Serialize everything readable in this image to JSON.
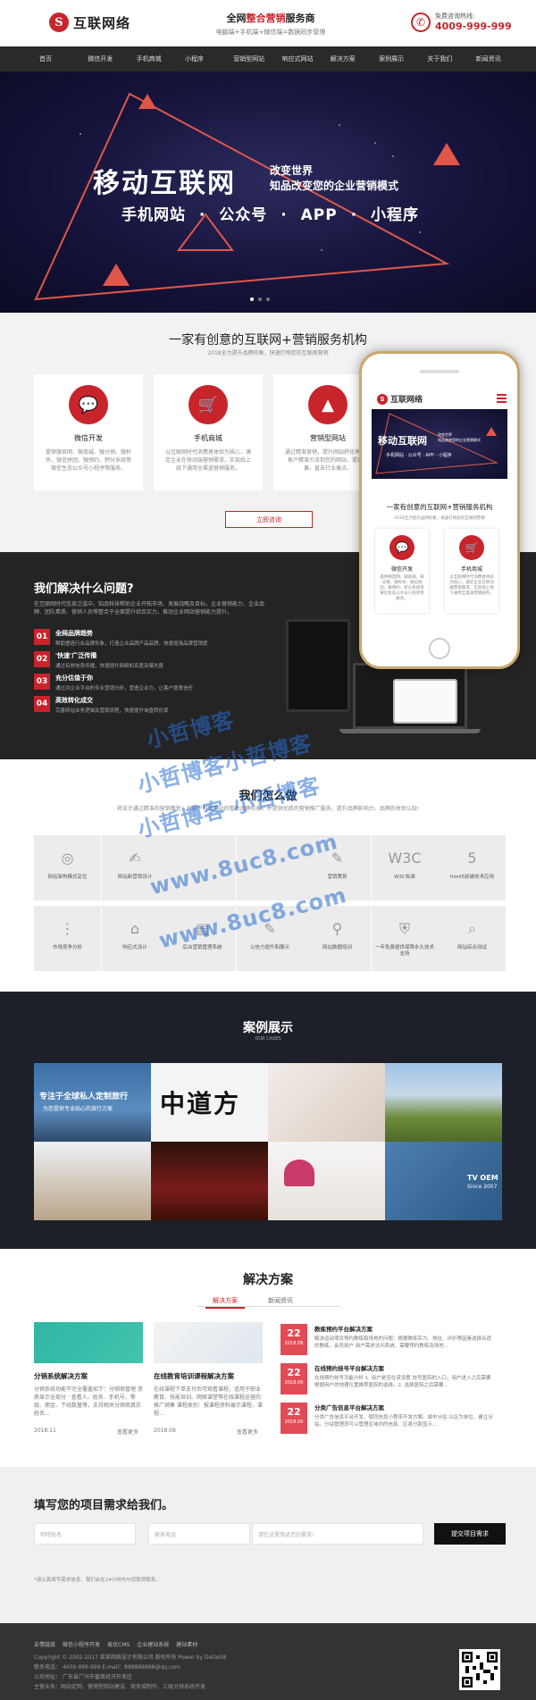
{
  "header": {
    "logo_letter": "S",
    "logo_text": "互联网络",
    "slogan_pre": "全网",
    "slogan_red": "整合营销",
    "slogan_post": "服务商",
    "slogan_sub": "电脑端+手机端+微信端=数据同步管理",
    "phone_label": "免费咨询热线:",
    "phone_number": "4009-999-999"
  },
  "nav": [
    "首页",
    "微信开发",
    "手机商城",
    "小程序",
    "营销型网站",
    "响应式网站",
    "解决方案",
    "案例展示",
    "关于我们",
    "新闻资讯"
  ],
  "banner": {
    "title": "移动互联网",
    "sub1": "改变世界",
    "sub2": "知品改变您的企业营销模式",
    "line": "手机网站 · 公众号 · APP · 小程序"
  },
  "intro": {
    "title": "一家有创意的互联网+营销服务机构",
    "subtitle": "2018全力提升品牌形象，快速打响您的互联网营销",
    "cards": [
      {
        "title": "微信开发",
        "desc": "提供微官网、微商城、微分销、微秒杀、微信拼团、微预约、积分系统等微信生态公众号小程序等服务。"
      },
      {
        "title": "手机商城",
        "desc": "以互联网时代消费者体验为核心，满足企业在移动端营销需求，实现线上线下通用全渠道营销服务。"
      },
      {
        "title": "营销型网站",
        "desc": "通过精准营销，提升网站转化率，将客户精准引流到您的网站，提升效果，直击行业痛点。"
      }
    ],
    "button": "立即咨询"
  },
  "solve": {
    "title": "我们解决什么问题?",
    "desc": "在互联网时代信息泛滥中，知品科技帮助企业开拓市场、发展战略及目标，企业营销能力、企业品牌、团队素质、营销人员等整合于全面提升综合实力，推动企业网站营销能力提升。",
    "items": [
      {
        "num": "01",
        "title": "全网品牌趋势",
        "desc": "帮助塑造行业品牌形象，打造企业品牌产品品牌，快速增强品牌营销度"
      },
      {
        "num": "02",
        "title": "'快速'广泛传播",
        "desc": "通过有效信息传播，快速提升网络知名度及曝光度"
      },
      {
        "num": "03",
        "title": "充分估值于你",
        "desc": "通过对企业平台的专业营销分析，营造企业力，让客户愿意信任"
      },
      {
        "num": "04",
        "title": "高效转化成交",
        "desc": "完善网站业务逻辑及营销流程，快速提升询盘转化率"
      }
    ]
  },
  "phone_mock": {
    "logo_text": "互联网络",
    "ban_title": "移动互联网",
    "ban_sub": "改变世界\n知品改变您的企业营销模式",
    "ban_line": "手机网站 · 公众号 · APP · 小程序",
    "title": "一家有创意的互联网+营销服务机构",
    "subtitle": "2018全力提升品牌形象，快速打响您的互联网营销",
    "cards": [
      {
        "title": "微信开发",
        "desc": "提供微官网、微商城、微分销、微秒杀、微信拼团、微预约、积分系统等微信生态公众号小程序等服务。"
      },
      {
        "title": "手机商城",
        "desc": "以互联网时代消费者体验为核心，满足企业在移动端营销需求，实现线上线下通用全渠道营销服务。"
      }
    ]
  },
  "how": {
    "title": "我们怎么做",
    "desc": "将设计通过精准的营销策划，为客户打造网站的整体品牌形象，并提供优质的营销推广服务，提升品牌影响力，品牌的体验认知!",
    "cells": [
      "网站架构模式定位",
      "网站新营销设计",
      "",
      "",
      "营销策划",
      "W3C标准",
      "html5前端技术应用",
      "市场竞争分析",
      "响应式设计",
      "后台营销管理系统",
      "公信力提升和展示",
      "网站数据培训",
      "一年免费提供保障永久技术支持",
      "网站综合测试"
    ]
  },
  "watermark": [
    "小哲博客",
    "小哲博客小哲博客",
    "小哲博客 小哲博客",
    "www.8uc8.com",
    "www.8uc8.com"
  ],
  "cases": {
    "title": "案例展示",
    "subtitle": "OUR CASES",
    "case1_line1": "专注于全球私人定制旅行",
    "case1_line2": "为您提供专业贴心的旅行方案",
    "case2_text": "中道方",
    "case4_text": "TV OEM",
    "case4_sub": "Since 2007"
  },
  "solutions": {
    "title": "解决方案",
    "tab_active": "解决方案",
    "tab_other": "新闻资讯",
    "items": [
      {
        "title": "分销系统解决方案",
        "desc": "分销系统功能不完全覆盖如下：分销商管理 资质显示全部分 · 查看人、姓名、手机号、等级、佣金、下线数量等，支持相关分销商真实姓名...",
        "date": "2018.11",
        "more": "查看更多"
      },
      {
        "title": "在线教育培训课程解决方案",
        "desc": "在线课程下单支付后可观看课程，适用于职业教育、技能培训、网络课堂等在线课程运营的推广销售 课程类别：报课程资料展示课程、课程...",
        "date": "2018.09",
        "more": "查看更多"
      }
    ],
    "news": [
      {
        "day": "22",
        "month": "2018.09",
        "title": "教练预约平台解决方案",
        "desc": "解决运动项目预约教练和场地的问题：根据教练实力、地址、评价等因素选择合适的教练。会员用户 用户需求访问系统、需要预约教练及场地..."
      },
      {
        "day": "22",
        "month": "2018.09",
        "title": "在线预约挂号平台解决方案",
        "desc": "在线预约挂号功能分析 1. 用户是否在该设置 挂号医院的入口，用户进入之后需要根据用户的地理位置推荐医院的选择。2. 选择医院之后需要..."
      },
      {
        "day": "22",
        "month": "2018.09",
        "title": "分类广告信息平台解决方案",
        "desc": "分类广告信息平台开发，使同信息小程序开发方案。城市分站 以区为单位，建立分站。分站管理员可以管理区域内的信息、区县分割显示..."
      }
    ]
  },
  "form": {
    "title": "填写您的项目需求给我们。",
    "name_ph": "称呼姓名",
    "phone_ph": "联系电话",
    "need_ph": "请在这里简述您的需求!",
    "button": "提交项目需求",
    "note": "*请认真填写需求信息，我们会在24小时内与您取得联系。"
  },
  "footer": {
    "links": [
      "友情链接",
      "微信小程序开发",
      "易优CMS",
      "企业建站系统",
      "建站素材"
    ],
    "copyright": "Copyright © 2002-2017 某某网络设计有限公司 版权所有 Power by DeDe58",
    "contact": "联系电话： 4009-999-999    E-mail：888888888@qq.com",
    "address": "公司地址： 广东省广州市番禺经济开发区",
    "business": "主营业务：网站定制、营销型网站建设、商务城制作、三级分销系统开发"
  },
  "colors": {
    "brand_red": "#c8242b",
    "nav_bg": "#2a2a2a",
    "dark_bg": "#242424",
    "footer_bg": "#333333"
  }
}
